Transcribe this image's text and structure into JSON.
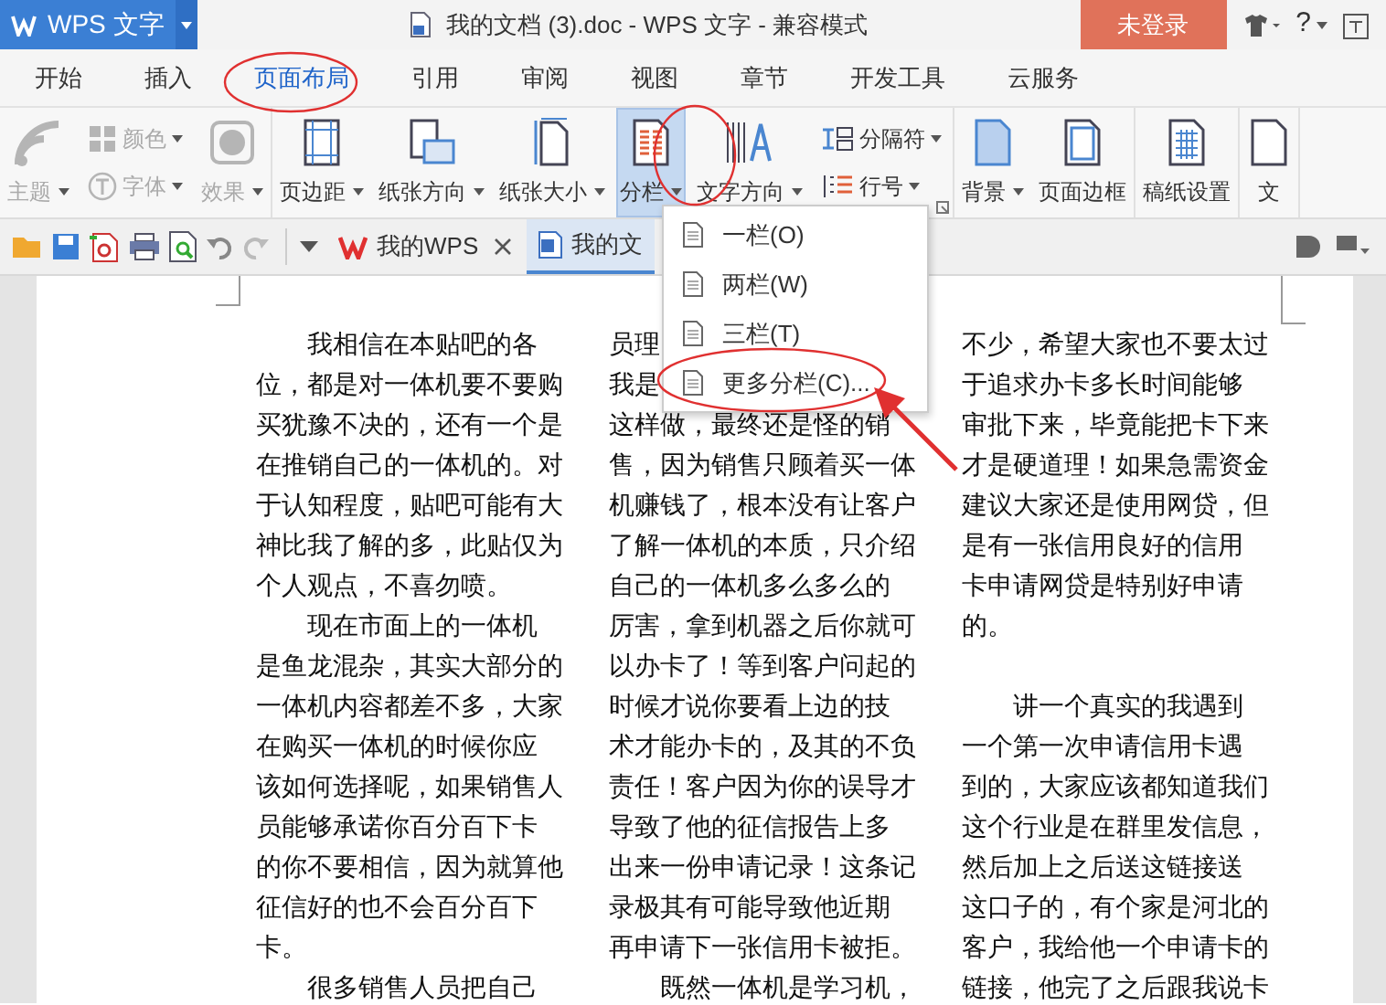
{
  "title_bar": {
    "app_menu": "WPS 文字",
    "title": "我的文档 (3).doc - WPS 文字 - 兼容模式",
    "login_button": "未登录",
    "help": "?"
  },
  "ribbon_tabs": [
    {
      "label": "开始",
      "selected": false
    },
    {
      "label": "插入",
      "selected": false
    },
    {
      "label": "页面布局",
      "selected": true
    },
    {
      "label": "引用",
      "selected": false
    },
    {
      "label": "审阅",
      "selected": false
    },
    {
      "label": "视图",
      "selected": false
    },
    {
      "label": "章节",
      "selected": false
    },
    {
      "label": "开发工具",
      "selected": false
    },
    {
      "label": "云服务",
      "selected": false
    }
  ],
  "ribbon": {
    "groups": [
      {
        "items": [
          {
            "kind": "big",
            "label": "主题",
            "dropdown": true,
            "disabled": true,
            "pressed": false
          },
          {
            "kind": "stack",
            "items": [
              {
                "label": "颜色",
                "dropdown": true,
                "disabled": true
              },
              {
                "label": "字体",
                "dropdown": true,
                "disabled": true
              }
            ]
          },
          {
            "kind": "big",
            "label": "效果",
            "dropdown": true,
            "disabled": true,
            "pressed": false
          }
        ]
      },
      {
        "launcher": true,
        "items": [
          {
            "kind": "big",
            "label": "页边距",
            "dropdown": true,
            "disabled": false,
            "pressed": false
          },
          {
            "kind": "big",
            "label": "纸张方向",
            "dropdown": true,
            "disabled": false,
            "pressed": false
          },
          {
            "kind": "big",
            "label": "纸张大小",
            "dropdown": true,
            "disabled": false,
            "pressed": false
          },
          {
            "kind": "big",
            "label": "分栏",
            "dropdown": true,
            "disabled": false,
            "pressed": true
          },
          {
            "kind": "big",
            "label": "文字方向",
            "dropdown": true,
            "disabled": false,
            "pressed": false
          },
          {
            "kind": "stack",
            "items": [
              {
                "label": "分隔符",
                "dropdown": true,
                "disabled": false
              },
              {
                "label": "行号",
                "dropdown": true,
                "disabled": false
              }
            ]
          }
        ]
      },
      {
        "items": [
          {
            "kind": "big",
            "label": "背景",
            "dropdown": true,
            "disabled": false,
            "pressed": false
          },
          {
            "kind": "big",
            "label": "页面边框",
            "disabled": false,
            "pressed": false
          }
        ]
      },
      {
        "items": [
          {
            "kind": "big",
            "label": "稿纸设置",
            "disabled": false,
            "pressed": false
          }
        ]
      },
      {
        "items": [
          {
            "kind": "big",
            "label": "文",
            "disabled": false,
            "pressed": false
          }
        ]
      }
    ]
  },
  "doc_tabs": [
    {
      "label": "我的WPS",
      "selected": false,
      "closable": true
    },
    {
      "label": "我的文",
      "selected": true
    }
  ],
  "dropdown_menu": {
    "items": [
      {
        "label": "一栏(O)"
      },
      {
        "label": "两栏(W)"
      },
      {
        "label": "三栏(T)"
      },
      {
        "label": "更多分栏(C)..."
      }
    ]
  },
  "document": {
    "columns": [
      {
        "paragraphs": [
          {
            "kind": "text",
            "indent": true,
            "lines": [
              "我相信在本贴吧的各",
              "位，都是对一体机要不要购",
              "买犹豫不决的，还有一个是",
              "在推销自己的一体机的。对",
              "于认知程度，贴吧可能有大",
              "神比我了解的多，此贴仅为",
              "个人观点，不喜勿喷。"
            ]
          },
          {
            "kind": "text",
            "indent": true,
            "lines": [
              "现在市面上的一体机",
              "是鱼龙混杂，其实大部分的",
              "一体机内容都差不多，大家",
              "在购买一体机的时候你应",
              "该如何选择呢，如果销售人",
              "员能够承诺你百分百下卡",
              "的你不要相信，因为就算他",
              "征信好的也不会百分百下",
              "卡。"
            ]
          },
          {
            "kind": "text",
            "indent": true,
            "lines": [
              "很多销售人员把自己"
            ]
          }
        ]
      },
      {
        "paragraphs": [
          {
            "kind": "text",
            "indent": false,
            "lines": [
              "员理",
              "我是",
              "这样做，最终还是怪的销",
              "售，因为销售只顾着买一体",
              "机赚钱了，根本没有让客户",
              "了解一体机的本质，只介绍",
              "自己的一体机多么多么的",
              "厉害，拿到机器之后你就可",
              "以办卡了！等到客户问起的",
              "时候才说你要看上边的技",
              "术才能办卡的，及其的不负",
              "责任！客户因为你的误导才",
              "导致了他的征信报告上多",
              "出来一份申请记录！这条记",
              "录极其有可能导致他近期",
              "再申请下一张信用卡被拒。"
            ]
          },
          {
            "kind": "text",
            "indent": true,
            "lines": [
              "既然一体机是学习机，"
            ]
          }
        ]
      },
      {
        "paragraphs": [
          {
            "kind": "text",
            "indent": false,
            "lines": [
              "不少，希望大家也不要太过",
              "于追求办卡多长时间能够",
              "审批下来，毕竟能把卡下来",
              "才是硬道理！如果急需资金",
              "建议大家还是使用网贷，但",
              "是有一张信用良好的信用",
              "卡申请网贷是特别好申请",
              "的。"
            ]
          },
          {
            "kind": "blank"
          },
          {
            "kind": "text",
            "indent": true,
            "lines": [
              "讲一个真实的我遇到",
              "一个第一次申请信用卡遇",
              "到的，大家应该都知道我们",
              "这个行业是在群里发信息，",
              "然后加上之后送这链接送",
              "这口子的，有个家是河北的",
              "客户，我给他一个申请卡的",
              "链接，他完了之后跟我说卡"
            ]
          }
        ]
      }
    ]
  }
}
